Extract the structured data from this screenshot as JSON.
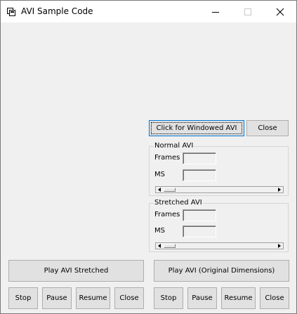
{
  "window": {
    "title": "AVI Sample Code",
    "icons": {
      "app": "avi-app-icon",
      "minimize": "minimize-icon",
      "maximize": "maximize-icon",
      "close": "close-icon"
    }
  },
  "top_buttons": {
    "windowed_avi": "Click for Windowed AVI",
    "close": "Close"
  },
  "normal_avi": {
    "title": "Normal AVI",
    "frames_label": "Frames",
    "frames_value": "",
    "ms_label": "MS",
    "ms_value": ""
  },
  "stretched_avi": {
    "title": "Stretched AVI",
    "frames_label": "Frames",
    "frames_value": "",
    "ms_label": "MS",
    "ms_value": ""
  },
  "left_panel": {
    "play": "Play AVI Stretched",
    "stop": "Stop",
    "pause": "Pause",
    "resume": "Resume",
    "close": "Close"
  },
  "right_panel": {
    "play": "Play AVI (Original Dimensions)",
    "stop": "Stop",
    "pause": "Pause",
    "resume": "Resume",
    "close": "Close"
  },
  "colors": {
    "window_bg": "#f0f0f0",
    "titlebar_bg": "#ffffff",
    "button_bg": "#e1e1e1",
    "button_border": "#adadad",
    "focus_border": "#0078d7"
  }
}
